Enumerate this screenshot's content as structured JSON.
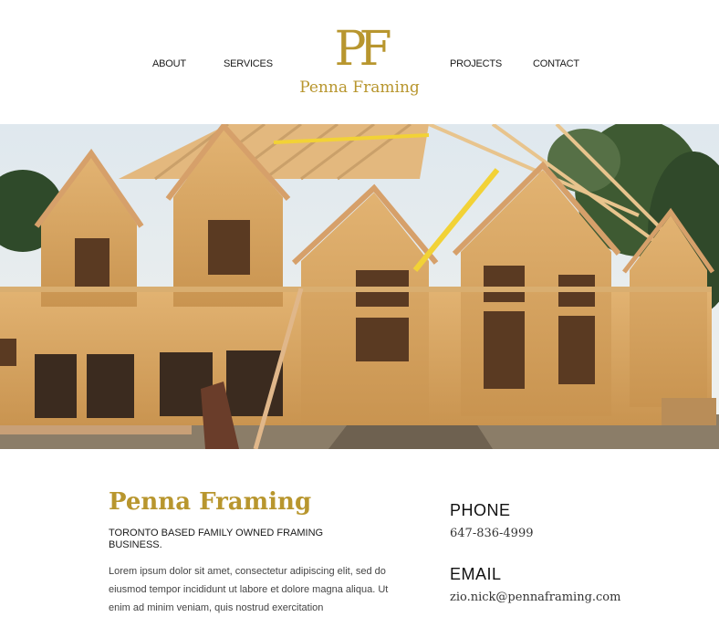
{
  "nav": {
    "about": "ABOUT",
    "services": "SERVICES",
    "projects": "PROJECTS",
    "contact": "CONTACT"
  },
  "logo": {
    "mark": "PF",
    "name": "Penna Framing"
  },
  "slider": {
    "slide_count": 4,
    "active_slide": 1
  },
  "intro": {
    "title": "Penna Framing",
    "tagline": "TORONTO BASED FAMILY OWNED FRAMING BUSINESS.",
    "body": "Lorem ipsum dolor sit amet, consectetur adipiscing elit, sed do eiusmod tempor incididunt ut labore et dolore magna aliqua. Ut enim ad minim veniam, quis nostrud exercitation"
  },
  "contact": {
    "phone_label": "PHONE",
    "phone": "647-836-4999",
    "email_label": "EMAIL",
    "email": "zio.nick@pennaframing.com"
  },
  "colors": {
    "brand_gold": "#b8962e",
    "osb_wood": "#d9a760",
    "sky": "#e8eef2"
  }
}
